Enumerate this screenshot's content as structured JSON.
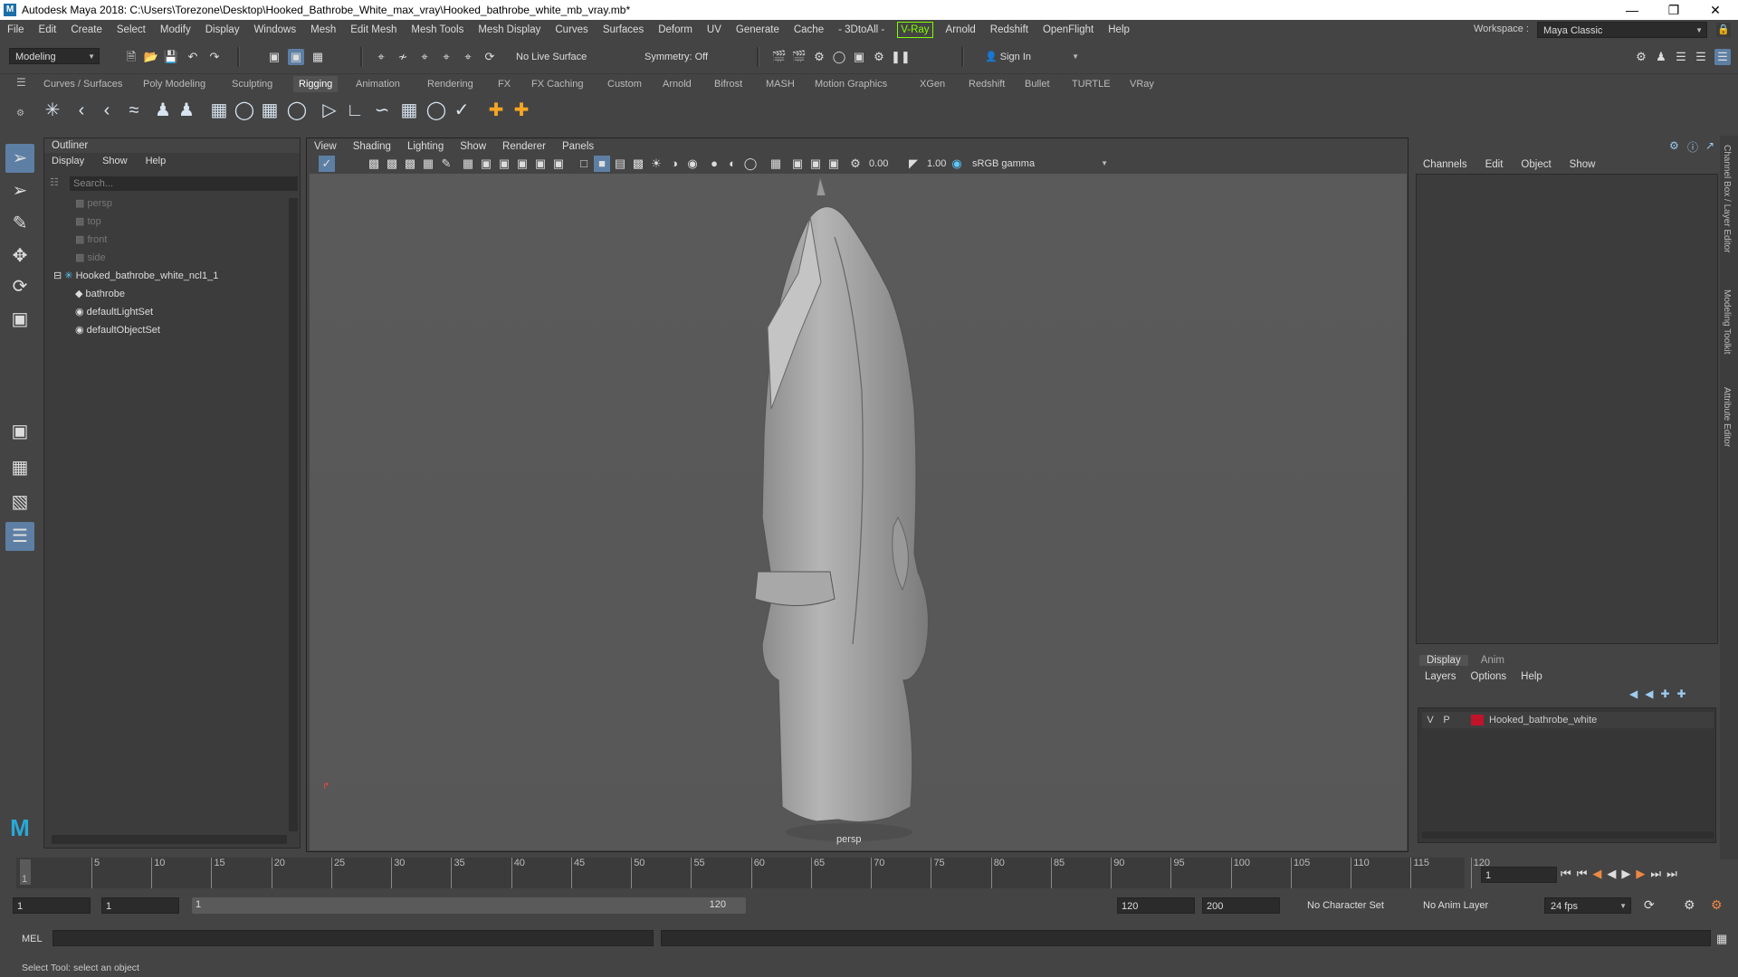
{
  "window": {
    "title": "Autodesk Maya 2018: C:\\Users\\Torezone\\Desktop\\Hooked_Bathrobe_White_max_vray\\Hooked_bathrobe_white_mb_vray.mb*"
  },
  "menubar": {
    "items": [
      "File",
      "Edit",
      "Create",
      "Select",
      "Modify",
      "Display",
      "Windows",
      "Mesh",
      "Edit Mesh",
      "Mesh Tools",
      "Mesh Display",
      "Curves",
      "Surfaces",
      "Deform",
      "UV",
      "Generate",
      "Cache",
      "- 3DtoAll -",
      "V-Ray",
      "Arnold",
      "Redshift",
      "OpenFlight",
      "Help"
    ],
    "workspace_label": "Workspace :",
    "workspace_value": "Maya Classic"
  },
  "statusline": {
    "mode": "Modeling",
    "live_surface": "No Live Surface",
    "symmetry": "Symmetry: Off",
    "sign_in": "Sign In"
  },
  "shelf": {
    "tabs": [
      "Curves / Surfaces",
      "Poly Modeling",
      "Sculpting",
      "Rigging",
      "Animation",
      "Rendering",
      "FX",
      "FX Caching",
      "Custom",
      "Arnold",
      "Bifrost",
      "MASH",
      "Motion Graphics",
      "XGen",
      "Redshift",
      "Bullet",
      "TURTLE",
      "VRay"
    ],
    "active_tab": "Rigging"
  },
  "outliner": {
    "title": "Outliner",
    "menu": [
      "Display",
      "Show",
      "Help"
    ],
    "search_placeholder": "Search...",
    "items": [
      {
        "label": "persp",
        "dim": true
      },
      {
        "label": "top",
        "dim": true
      },
      {
        "label": "front",
        "dim": true
      },
      {
        "label": "side",
        "dim": true
      },
      {
        "label": "Hooked_bathrobe_white_ncl1_1",
        "dim": false
      },
      {
        "label": "bathrobe",
        "dim": false
      },
      {
        "label": "defaultLightSet",
        "dim": false
      },
      {
        "label": "defaultObjectSet",
        "dim": false
      }
    ]
  },
  "viewport": {
    "menu": [
      "View",
      "Shading",
      "Lighting",
      "Show",
      "Renderer",
      "Panels"
    ],
    "exposure": "0.00",
    "gamma": "1.00",
    "color_space": "sRGB gamma",
    "camera_label": "persp"
  },
  "channelbox": {
    "menu": [
      "Channels",
      "Edit",
      "Object",
      "Show"
    ]
  },
  "layers": {
    "tabs": [
      "Display",
      "Anim"
    ],
    "menu": [
      "Layers",
      "Options",
      "Help"
    ],
    "row": {
      "v": "V",
      "p": "P",
      "name": "Hooked_bathrobe_white",
      "color": "#c0142a"
    }
  },
  "sidebar_labels": [
    "Channel Box / Layer Editor",
    "Modeling Toolkit",
    "Attribute Editor"
  ],
  "timeslider": {
    "ticks": [
      "5",
      "10",
      "15",
      "20",
      "25",
      "30",
      "35",
      "40",
      "45",
      "50",
      "55",
      "60",
      "65",
      "70",
      "75",
      "80",
      "85",
      "90",
      "95",
      "100",
      "105",
      "110",
      "115",
      "120"
    ],
    "start_tick": "1",
    "current_frame": "1"
  },
  "rangeslider": {
    "start": "1",
    "playback_start": "1",
    "range_start_label": "1",
    "range_end_label": "120",
    "playback_end": "120",
    "end": "200",
    "character_set": "No Character Set",
    "anim_layer": "No Anim Layer",
    "fps": "24 fps"
  },
  "cmdline": {
    "label": "MEL"
  },
  "helpline": {
    "text": "Select Tool: select an object"
  }
}
